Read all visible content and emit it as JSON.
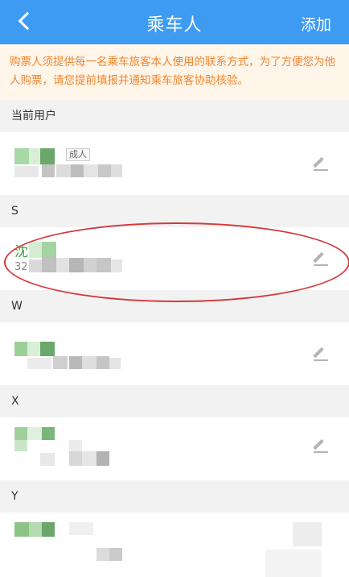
{
  "header": {
    "back_icon": "chevron-left-icon",
    "title": "乘车人",
    "add_label": "添加"
  },
  "notice": {
    "text": "购票人须提供每一名乘车旅客本人使用的联系方式，为了方便您为他人购票，请您提前填报并通知乘车旅客协助核验。"
  },
  "sections": {
    "current_user": "当前用户",
    "s": "S",
    "w": "W",
    "x": "X",
    "y": "Y"
  },
  "passengers": {
    "current": {
      "badge": "成人"
    },
    "s_first": {
      "surname": "沈",
      "id_prefix": "32"
    }
  },
  "colors": {
    "header_bg": "#3d9bf2",
    "notice_bg": "#fff5e9",
    "notice_text": "#f08630",
    "highlight_ellipse": "#d23a3a"
  }
}
